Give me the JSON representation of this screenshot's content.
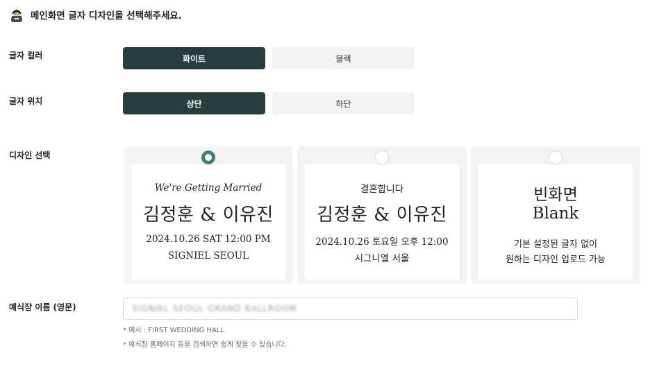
{
  "header": {
    "title": "메인화면 글자 디자인을 선택해주세요.",
    "icon": "person-avatar-icon"
  },
  "text_color": {
    "label": "글자 컬러",
    "options": [
      "화이트",
      "블랙"
    ],
    "selected": "화이트"
  },
  "text_position": {
    "label": "글자 위치",
    "options": [
      "상단",
      "하단"
    ],
    "selected": "상단"
  },
  "design": {
    "label": "디자인 선택",
    "selected_index": 0,
    "cards": [
      {
        "script": "We're Getting Married",
        "names": "김정훈 & 이유진",
        "line1": "2024.10.26 SAT 12:00 PM",
        "line2": "SIGNIEL SEOUL"
      },
      {
        "top": "결혼합니다",
        "names": "김정훈 & 이유진",
        "line1": "2024.10.26 토요일 오후 12:00",
        "line2": "시그니엘 서울"
      },
      {
        "title": "빈화면",
        "subtitle": "Blank",
        "desc1": "기본 설정된 글자 없이",
        "desc2": "원하는 디자인 업로드 가능"
      }
    ]
  },
  "venue": {
    "label": "예식장 이름 (영문)",
    "value": "SIGNIEL SEOUL GRAND BALLROOM",
    "hint1": "* 예시 : FIRST WEDDING HALL",
    "hint2": "* 예식장 홈페이지 등을 검색하면 쉽게 찾을 수 있습니다."
  },
  "colors": {
    "accent": "#263f3e",
    "radio": "#3f8080",
    "inactive": "#f2f2f2",
    "card_bg": "#f2f4f4"
  }
}
